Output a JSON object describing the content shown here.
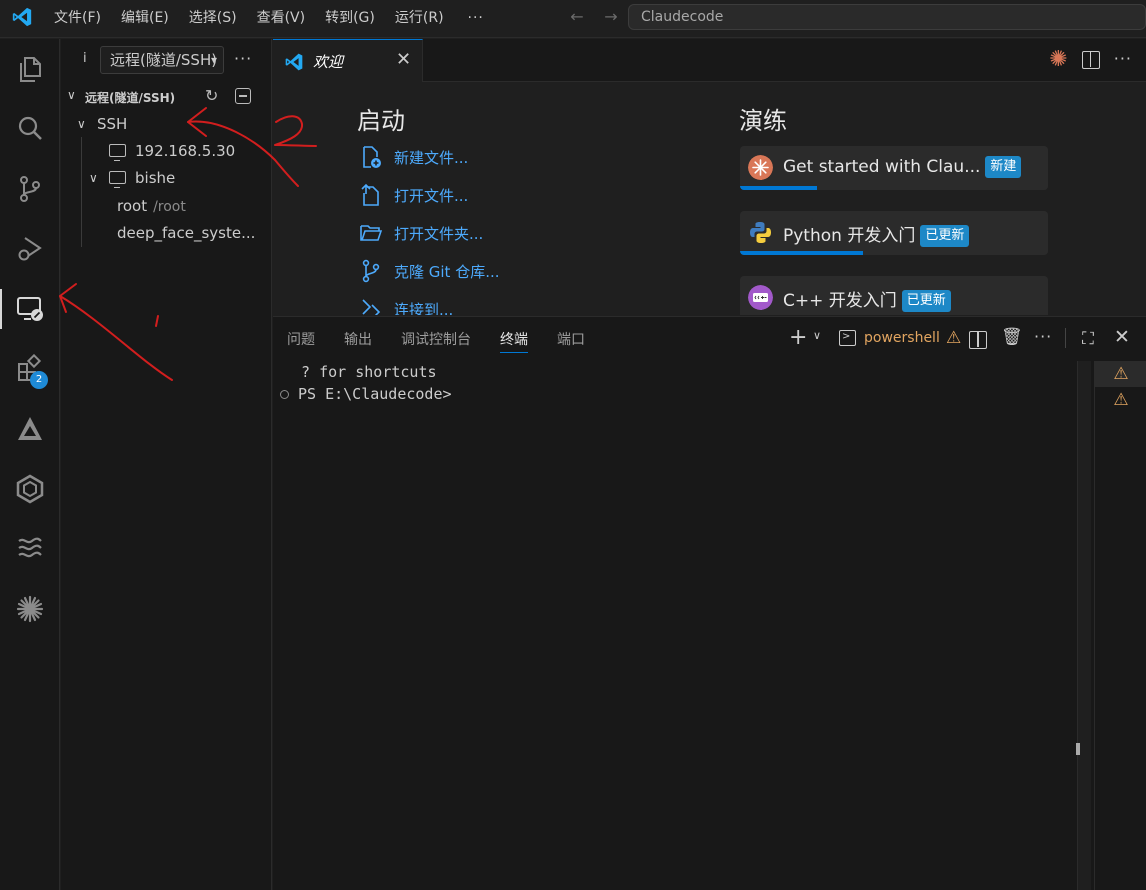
{
  "titlebar": {
    "menu": [
      "文件(F)",
      "编辑(E)",
      "选择(S)",
      "查看(V)",
      "转到(G)",
      "运行(R)"
    ],
    "more": "···",
    "search": "Claudecode"
  },
  "activitybar": {
    "items": [
      {
        "name": "explorer-icon"
      },
      {
        "name": "search-icon"
      },
      {
        "name": "source-control-icon"
      },
      {
        "name": "run-debug-icon"
      },
      {
        "name": "remote-explorer-icon"
      },
      {
        "name": "extensions-icon",
        "badge": "2"
      },
      {
        "name": "extension-a-icon"
      },
      {
        "name": "extension-hex-icon"
      },
      {
        "name": "extension-wave-icon"
      },
      {
        "name": "claude-icon"
      }
    ]
  },
  "sidebar": {
    "info": "i",
    "select_value": "远程(隧道/SSH)",
    "section_title": "远程(隧道/SSH)",
    "tree": {
      "group": "SSH",
      "hosts": [
        {
          "label": "192.168.5.30"
        },
        {
          "label": "bishe",
          "children": [
            {
              "label": "root",
              "desc": "/root"
            },
            {
              "label": "deep_face_syste..."
            }
          ]
        }
      ]
    }
  },
  "editor": {
    "tab_label": "欢迎",
    "welcome": {
      "start_heading": "启动",
      "start_items": [
        "新建文件...",
        "打开文件...",
        "打开文件夹...",
        "克隆 Git 仓库...",
        "连接到..."
      ],
      "walk_heading": "演练",
      "walkthroughs": [
        {
          "title": "Get started with Clau...",
          "badge": "新建",
          "progress": 0.25
        },
        {
          "title": "Python 开发入门",
          "badge": "已更新",
          "progress": 0.4
        },
        {
          "title": "C++ 开发入门",
          "badge": "已更新",
          "progress": 0
        }
      ]
    }
  },
  "panel": {
    "tabs": [
      "问题",
      "输出",
      "调试控制台",
      "终端",
      "端口"
    ],
    "active_tab": "终端",
    "terminal_name": "powershell",
    "terminal_lines": [
      "  ? for shortcuts",
      "PS E:\\Claudecode>"
    ]
  },
  "colors": {
    "accent": "#0078d4",
    "link": "#4daafc",
    "warning": "#e2a560",
    "badge": "#1d88c7",
    "annotation": "#d21e1e"
  }
}
